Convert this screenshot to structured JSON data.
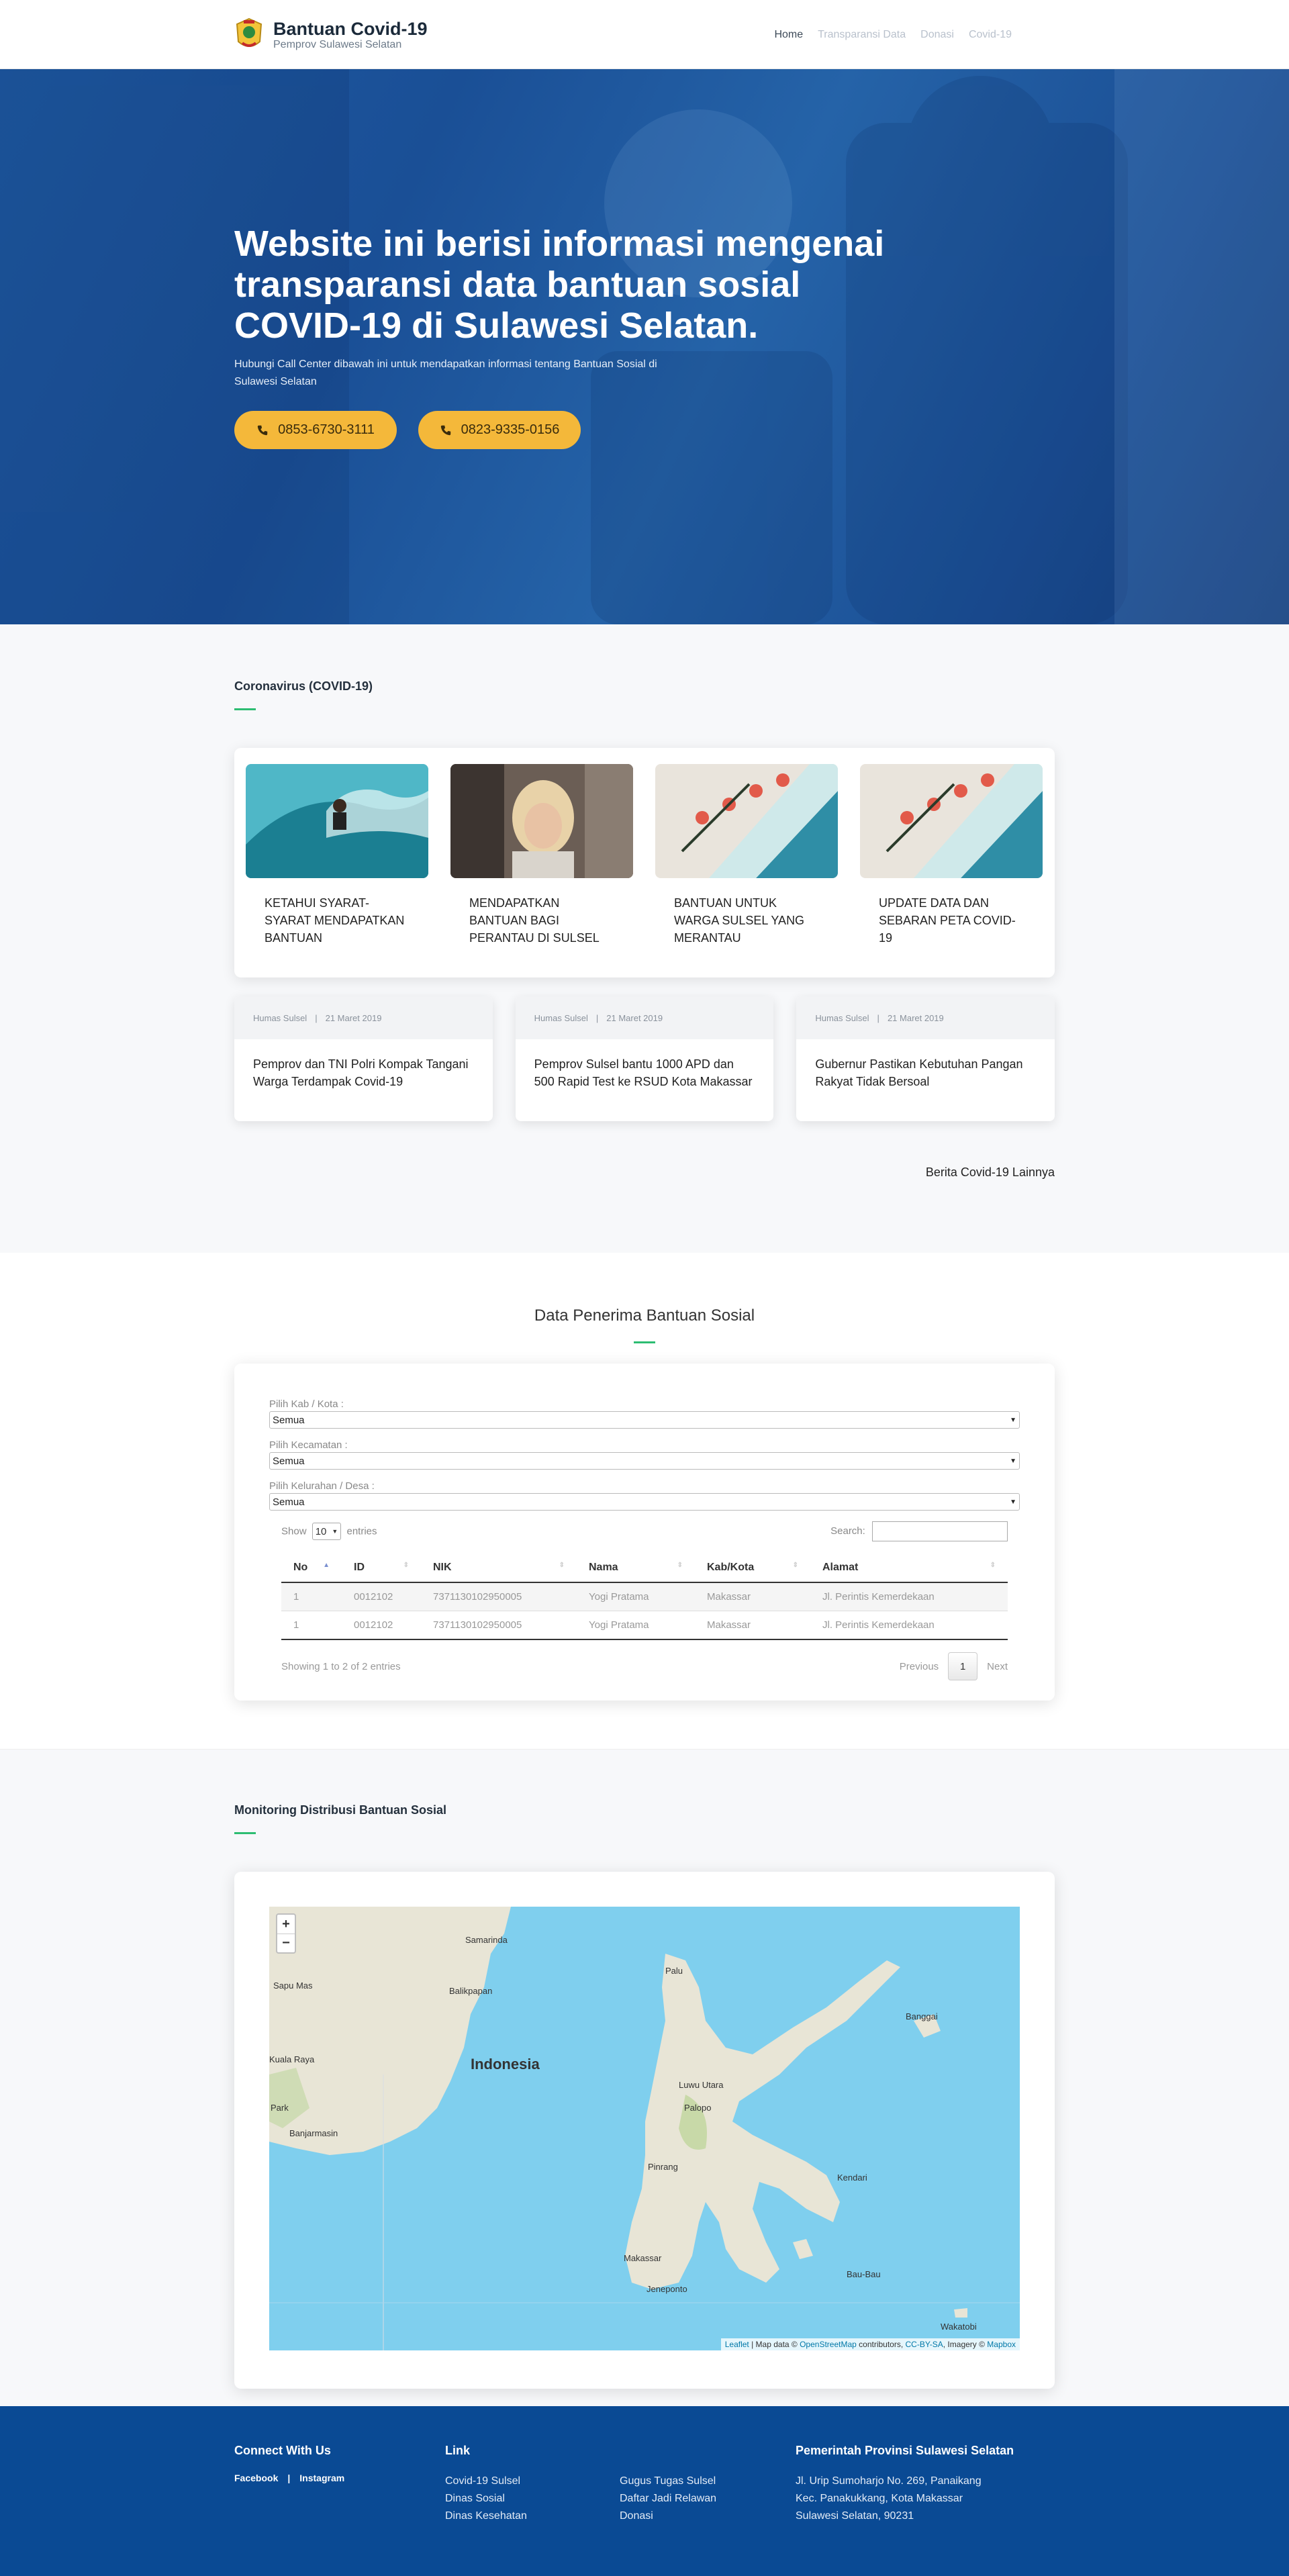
{
  "nav": {
    "brand_title": "Bantuan Covid-19",
    "brand_subtitle": "Pemprov Sulawesi Selatan",
    "items": [
      "Home",
      "Transparansi Data",
      "Donasi",
      "Covid-19"
    ]
  },
  "hero": {
    "title": "Website ini berisi informasi mengenai transparansi data bantuan sosial COVID-19 di Sulawesi Selatan.",
    "subtitle": "Hubungi Call Center dibawah ini untuk mendapatkan informasi tentang Bantuan Sosial di Sulawesi Selatan",
    "phones": [
      "0853-6730-3111",
      "0823-9335-0156"
    ]
  },
  "covid": {
    "title": "Coronavirus (COVID-19)",
    "topics": [
      "KETAHUI SYARAT-SYARAT MENDAPATKAN BANTUAN",
      "MENDAPATKAN BANTUAN BAGI PERANTAU DI SULSEL",
      "BANTUAN UNTUK WARGA SULSEL YANG MERANTAU",
      "UPDATE DATA DAN SEBARAN PETA COVID-19"
    ],
    "news": [
      {
        "author": "Humas Sulsel",
        "date": "21 Maret 2019",
        "title": "Pemprov dan TNI Polri Kompak Tangani Warga Terdampak Covid-19"
      },
      {
        "author": "Humas Sulsel",
        "date": "21 Maret 2019",
        "title": "Pemprov Sulsel bantu 1000 APD dan 500 Rapid Test ke RSUD Kota Makassar"
      },
      {
        "author": "Humas Sulsel",
        "date": "21 Maret 2019",
        "title": "Gubernur Pastikan Kebutuhan Pangan Rakyat Tidak Bersoal"
      }
    ],
    "more_link": "Berita Covid-19 Lainnya"
  },
  "penerima": {
    "title": "Data Penerima Bantuan Sosial",
    "filters": [
      {
        "label": "Pilih Kab / Kota  :",
        "value": "Semua"
      },
      {
        "label": "Pilih Kecamatan :",
        "value": "Semua"
      },
      {
        "label": "Pilih Kelurahan / Desa  :",
        "value": "Semua"
      }
    ],
    "show_label": "Show",
    "entries_value": "10",
    "entries_label": "entries",
    "search_label": "Search:",
    "columns": [
      "No",
      "ID",
      "NIK",
      "Nama",
      "Kab/Kota",
      "Alamat"
    ],
    "rows": [
      [
        "1",
        "0012102",
        "7371130102950005",
        "Yogi Pratama",
        "Makassar",
        "Jl. Perintis Kemerdekaan"
      ],
      [
        "1",
        "0012102",
        "7371130102950005",
        "Yogi Pratama",
        "Makassar",
        "Jl. Perintis Kemerdekaan"
      ]
    ],
    "info": "Showing 1 to 2 of 2 entries",
    "prev": "Previous",
    "page": "1",
    "next": "Next"
  },
  "monitor": {
    "title": "Monitoring Distribusi Bantuan Sosial",
    "zoom_in": "+",
    "zoom_out": "−",
    "country": "Indonesia",
    "cities": [
      "Samarinda",
      "Balikpapan",
      "Banjarmasin",
      "Palu",
      "Luwu Utara",
      "Palopo",
      "Pinrang",
      "Makassar",
      "Jeneponto",
      "Kendari",
      "Bau-Bau",
      "Banggai",
      "Wakatobi",
      "Sapu Mas",
      "Kuala Raya",
      "Park"
    ],
    "attribution_leaflet": "Leaflet",
    "attribution_text": " | Map data © ",
    "attribution_osm": "OpenStreetMap",
    "attribution_mid": " contributors, ",
    "attribution_cc": "CC-BY-SA",
    "attribution_img": ", Imagery © ",
    "attribution_mapbox": "Mapbox"
  },
  "footer": {
    "connect_title": "Connect With Us",
    "social": [
      "Facebook",
      "|",
      "Instagram"
    ],
    "link_title": "Link",
    "links_a": [
      "Covid-19 Sulsel",
      "Dinas Sosial",
      "Dinas Kesehatan"
    ],
    "links_b": [
      "Gugus Tugas Sulsel",
      "Daftar Jadi Relawan",
      "Donasi"
    ],
    "gov_title": "Pemerintah Provinsi Sulawesi Selatan",
    "address": [
      "Jl. Urip Sumoharjo No. 269, Panaikang",
      "Kec. Panakukkang, Kota Makassar",
      "Sulawesi Selatan, 90231"
    ]
  }
}
